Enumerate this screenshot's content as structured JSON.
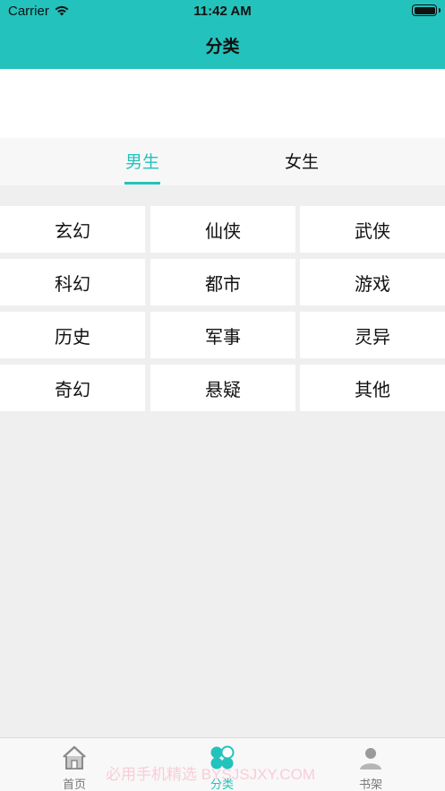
{
  "status_bar": {
    "carrier": "Carrier",
    "time": "11:42 AM"
  },
  "nav": {
    "title": "分类"
  },
  "tabs": [
    {
      "label": "男生",
      "selected": true
    },
    {
      "label": "女生",
      "selected": false
    }
  ],
  "categories": [
    "玄幻",
    "仙侠",
    "武侠",
    "科幻",
    "都市",
    "游戏",
    "历史",
    "军事",
    "灵异",
    "奇幻",
    "悬疑",
    "其他"
  ],
  "bottom_tabs": [
    {
      "label": "首页",
      "icon": "home-icon",
      "active": false
    },
    {
      "label": "分类",
      "icon": "category-icon",
      "active": true
    },
    {
      "label": "书架",
      "icon": "bookshelf-user-icon",
      "active": false
    }
  ],
  "watermark": "必用手机精选 BYSJSJXY.COM",
  "colors": {
    "accent": "#24c2bc",
    "background": "#efefef",
    "cell": "#ffffff"
  }
}
